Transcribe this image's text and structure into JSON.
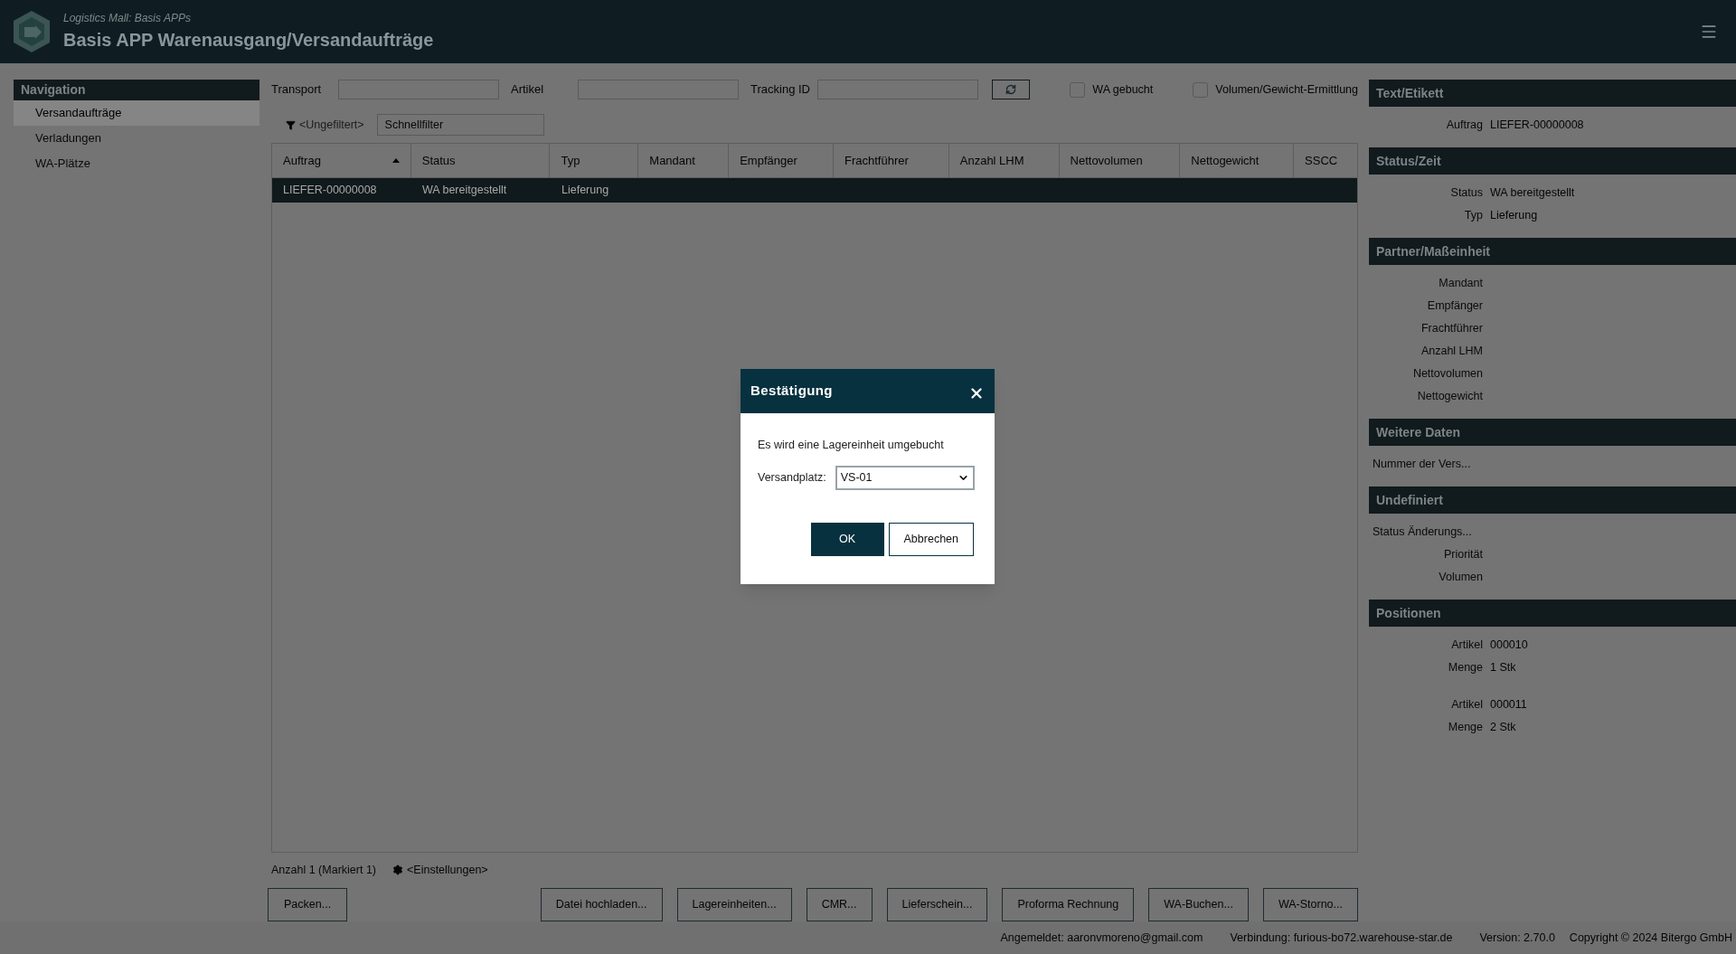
{
  "header": {
    "subtitle": "Logistics Mall: Basis APPs",
    "title": "Basis APP Warenausgang/Versandaufträge"
  },
  "navigation": {
    "title": "Navigation",
    "items": [
      {
        "label": "Versandaufträge",
        "selected": true
      },
      {
        "label": "Verladungen",
        "selected": false
      },
      {
        "label": "WA-Plätze",
        "selected": false
      }
    ]
  },
  "filters": [
    {
      "label": "Transport"
    },
    {
      "label": "Artikel"
    },
    {
      "label": "Tracking ID"
    }
  ],
  "checkboxes": [
    {
      "label": "WA gebucht",
      "checked": false
    },
    {
      "label": "Volumen/Gewicht-Ermittlung",
      "checked": false
    }
  ],
  "quickfilter": {
    "filter_label": "<Ungefiltert>",
    "placeholder": "Schnellfilter"
  },
  "table": {
    "columns": [
      {
        "label": "Auftrag",
        "sorted": true
      },
      {
        "label": "Status",
        "sorted": false
      },
      {
        "label": "Typ",
        "sorted": false
      },
      {
        "label": "Mandant",
        "sorted": false
      },
      {
        "label": "Empfänger",
        "sorted": false
      },
      {
        "label": "Frachtführer",
        "sorted": false
      },
      {
        "label": "Anzahl LHM",
        "sorted": false
      },
      {
        "label": "Nettovolumen",
        "sorted": false
      },
      {
        "label": "Nettogewicht",
        "sorted": false
      },
      {
        "label": "SSCC",
        "sorted": false
      }
    ],
    "rows": [
      {
        "cells": [
          "LIEFER-00000008",
          "WA bereitgestellt",
          "Lieferung"
        ],
        "selected": true
      }
    ]
  },
  "table_footer": {
    "count": "Anzahl 1 (Markiert 1)",
    "settings": "<Einstellungen>"
  },
  "left_buttons": [
    "Packen..."
  ],
  "right_buttons": [
    "Datei hochladen...",
    "Lagereinheiten...",
    "CMR...",
    "Lieferschein...",
    "Proforma Rechnung",
    "WA-Buchen...",
    "WA-Storno..."
  ],
  "details": [
    {
      "title": "Text/Etikett",
      "groups": [
        [
          {
            "kind": "pair",
            "label": "Auftrag",
            "value": "LIEFER-00000008"
          }
        ]
      ]
    },
    {
      "title": "Status/Zeit",
      "groups": [
        [
          {
            "kind": "pair",
            "label": "Status",
            "value": "WA bereitgestellt"
          },
          {
            "kind": "pair",
            "label": "Typ",
            "value": "Lieferung"
          }
        ]
      ]
    },
    {
      "title": "Partner/Maßeinheit",
      "groups": [
        [
          {
            "kind": "pair",
            "label": "Mandant"
          },
          {
            "kind": "pair",
            "label": "Empfänger"
          },
          {
            "kind": "pair",
            "label": "Frachtführer"
          },
          {
            "kind": "pair",
            "label": "Anzahl LHM"
          },
          {
            "kind": "pair",
            "label": "Nettovolumen"
          },
          {
            "kind": "pair",
            "label": "Nettogewicht"
          }
        ]
      ]
    },
    {
      "title": "Weitere Daten",
      "groups": [
        [
          {
            "kind": "long",
            "label": "Nummer der Vers..."
          }
        ]
      ]
    },
    {
      "title": "Undefiniert",
      "groups": [
        [
          {
            "kind": "long",
            "label": "Status Änderungs..."
          },
          {
            "kind": "pair",
            "label": "Priorität"
          },
          {
            "kind": "pair",
            "label": "Volumen"
          }
        ]
      ]
    },
    {
      "title": "Positionen",
      "groups": [
        [
          {
            "kind": "pair",
            "label": "Artikel",
            "value": "000010"
          },
          {
            "kind": "pair",
            "label": "Menge",
            "value": "1 Stk"
          }
        ],
        [
          {
            "kind": "pair",
            "label": "Artikel",
            "value": "000011"
          },
          {
            "kind": "pair",
            "label": "Menge",
            "value": "2 Stk"
          }
        ]
      ]
    }
  ],
  "status_bar": [
    "Angemeldet: aaronvmoreno@gmail.com",
    "Verbindung: furious-bo72.warehouse-star.de",
    "Version: 2.70.0",
    "Copyright © 2024 Bitergo GmbH"
  ],
  "dialog": {
    "title": "Bestätigung",
    "message": "Es wird eine Lagereinheit umgebucht",
    "field_label": "Versandplatz:",
    "select_value": "VS-01",
    "buttons": [
      {
        "label": "OK",
        "kind": "primary"
      },
      {
        "label": "Abbrechen",
        "kind": "secondary"
      }
    ]
  }
}
